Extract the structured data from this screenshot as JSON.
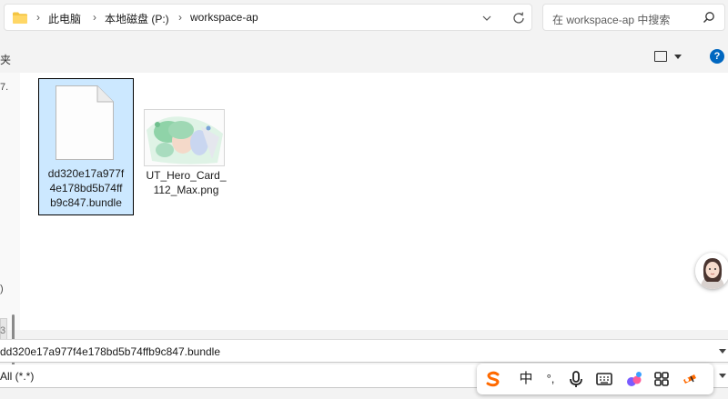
{
  "address": {
    "crumbs": [
      "此电脑",
      "本地磁盘 (P:)",
      "workspace-ap"
    ],
    "separator": "›"
  },
  "search": {
    "placeholder": "在 workspace-ap 中搜索"
  },
  "command": {
    "left_label": "夹",
    "help_label": "?"
  },
  "sidebar": {
    "fragments": [
      "7.",
      "3",
      ")"
    ]
  },
  "files": [
    {
      "name": "dd320e17a977f4e178bd5b74ffb9c847.bundle",
      "label_lines": [
        "dd320e17a977f",
        "4e178bd5b74ff",
        "b9c847.bundle"
      ],
      "icon": "document-icon",
      "selected": true
    },
    {
      "name": "UT_Hero_Card_112_Max.png",
      "label_lines": [
        "UT_Hero_Card_",
        "112_Max.png"
      ],
      "icon": "image-thumbnail",
      "selected": false
    }
  ],
  "filename_field": {
    "value": "dd320e17a977f4e178bd5b74ffb9c847.bundle"
  },
  "filter_field": {
    "value": "All (*.*)"
  },
  "ime": {
    "items": [
      "S",
      "中",
      "°,",
      "mic-icon",
      "keyboard-icon",
      "skin-icon",
      "grid-icon",
      "tool-icon"
    ],
    "mode_label": "中",
    "punct_label": "°,"
  },
  "colors": {
    "accent": "#0067c0",
    "selection": "#cce8ff",
    "folder": "#f4c542",
    "ime_logo": "#ff6a00"
  }
}
